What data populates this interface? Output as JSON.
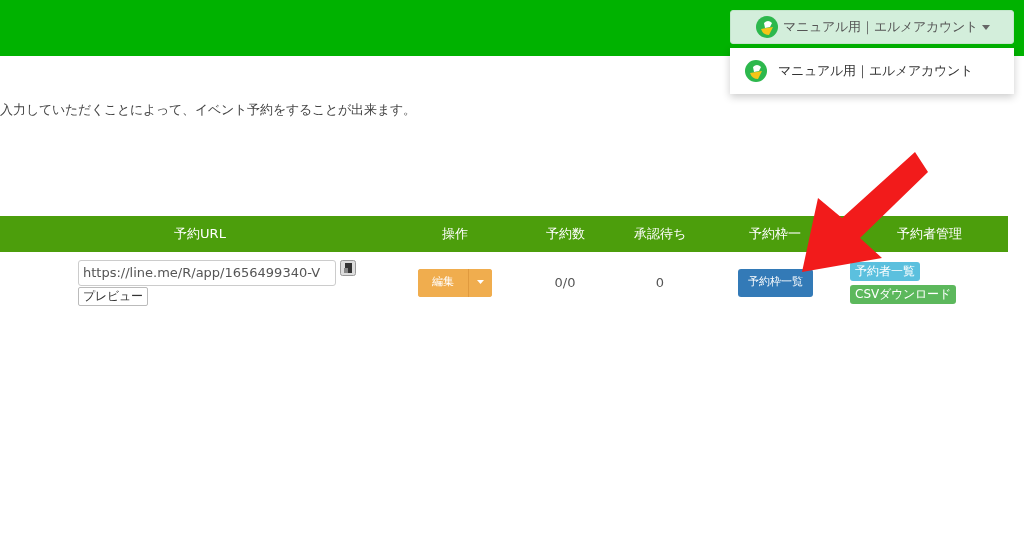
{
  "header": {
    "account_button": {
      "label": "マニュアル用｜エルメアカウント"
    }
  },
  "account_menu": {
    "items": [
      {
        "label": "マニュアル用｜エルメアカウント"
      }
    ]
  },
  "description": "入力していただくことによって、イベント予約をすることが出来ます。",
  "table": {
    "columns": [
      "予約URL",
      "操作",
      "予約数",
      "承認待ち",
      "予約枠一",
      "予約者管理"
    ],
    "rows": [
      {
        "url": "https://line.me/R/app/1656499340-V",
        "preview_button": "プレビュー",
        "edit_button": "編集",
        "count": "0/0",
        "pending": "0",
        "slots_button": "予約枠一覧",
        "manage_buttons": [
          {
            "label": "予約者一覧",
            "kind": "info"
          },
          {
            "label": "CSVダウンロード",
            "kind": "success"
          }
        ]
      }
    ]
  }
}
